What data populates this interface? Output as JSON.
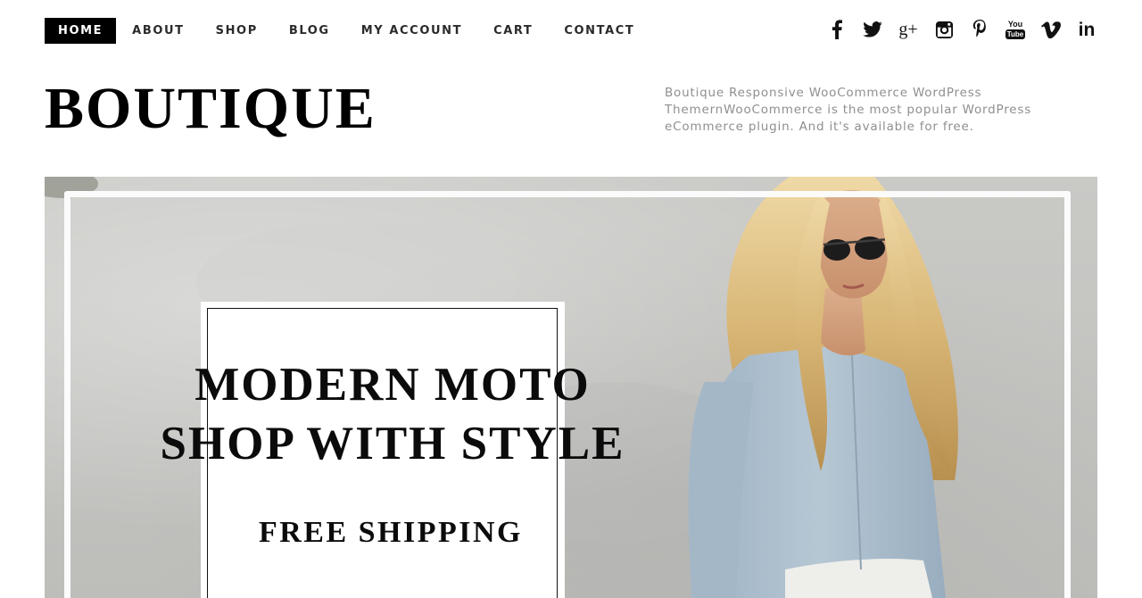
{
  "nav": {
    "items": [
      {
        "label": "HOME",
        "active": true
      },
      {
        "label": "ABOUT"
      },
      {
        "label": "SHOP"
      },
      {
        "label": "BLOG"
      },
      {
        "label": "MY ACCOUNT"
      },
      {
        "label": "CART"
      },
      {
        "label": "CONTACT"
      }
    ]
  },
  "social": {
    "icons": [
      "facebook-icon",
      "twitter-icon",
      "google-plus-icon",
      "instagram-icon",
      "pinterest-icon",
      "youtube-icon",
      "vimeo-icon",
      "linkedin-icon"
    ],
    "google_plus_text": "g+",
    "youtube_text_top": "You",
    "youtube_text_bottom": "Tube",
    "linkedin_text": "in"
  },
  "header": {
    "site_title": "BOUTIQUE",
    "tagline": "Boutique Responsive WooCommerce WordPress ThemernWooCommerce is the most popular WordPress eCommerce plugin. And it's available for free."
  },
  "hero": {
    "heading_line1": "MODERN MOTO",
    "heading_line2": "SHOP WITH STYLE",
    "subheading": "FREE SHIPPING"
  },
  "colors": {
    "nav_active_bg": "#000000",
    "nav_text": "#2b2b2b",
    "tagline_text": "#8f8f8f",
    "hero_bg": "#c6c6c3",
    "shirt": "#a9bccb",
    "hair": "#d9b77a"
  }
}
